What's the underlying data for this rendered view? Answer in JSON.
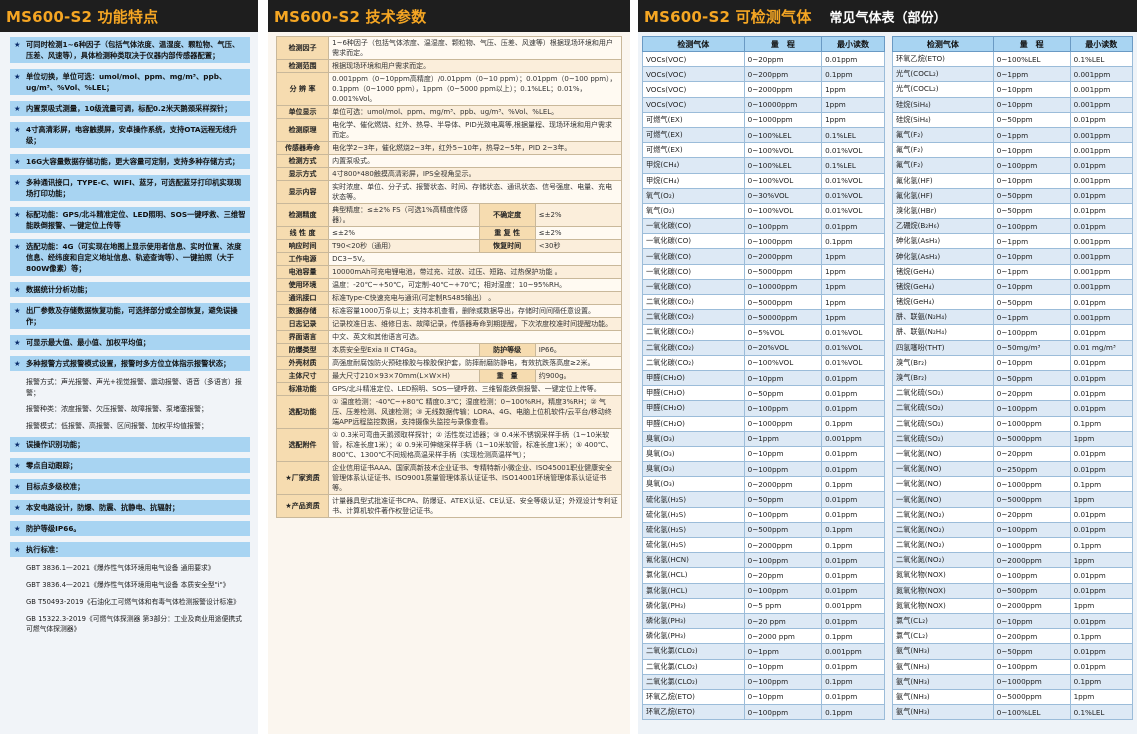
{
  "panel1": {
    "title": "MS600-S2 功能特点",
    "features": [
      {
        "type": "feat",
        "text": "可同时检测1~6种因子（包括气体浓度、温湿度、颗粒物、气压、压差、风速等），具体检测种类取决于仪器内部传感器配置；"
      },
      {
        "type": "feat",
        "text": "单位切换，单位可选：umol/mol、ppm、mg/m³、ppb、ug/m³、%Vol、%LEL；"
      },
      {
        "type": "feat",
        "text": "内置泵吸式测量，10级流量可调，标配0.2米天鹅颈采样探针；"
      },
      {
        "type": "feat",
        "text": "4寸高清彩屏，电容触摸屏，安卓操作系统，支持OTA远程无线升级；"
      },
      {
        "type": "feat",
        "text": "16G大容量数据存储功能，更大容量可定制，支持多种存储方式；"
      },
      {
        "type": "feat",
        "text": "多种通讯接口，TYPE-C、WIFI、蓝牙，可选配蓝牙打印机实现现场打印功能；"
      },
      {
        "type": "feat",
        "text": "标配功能：GPS/北斗精准定位、LED照明、SOS一键呼救、三维智能跌倒报警、一键定位上传等"
      },
      {
        "type": "feat",
        "text": "选配功能：4G（可实现在地图上显示使用者信息、实时位置、浓度信息、经纬度和自定义地址信息、轨迹查询等）、一键拍照（大于800W像素）等；"
      },
      {
        "type": "feat",
        "text": "数据统计分析功能；"
      },
      {
        "type": "feat",
        "text": "出厂参数及存储数据恢复功能，可选择部分或全部恢复，避免误操作；"
      },
      {
        "type": "feat",
        "text": "可显示最大值、最小值、加权平均值；"
      },
      {
        "type": "feat",
        "text": "多种报警方式报警模式设置，报警时多方位立体指示报警状态；"
      },
      {
        "type": "sub",
        "text": "报警方式：声光报警、声光+视觉报警、震动报警、语音（多语言）报警；"
      },
      {
        "type": "sub",
        "text": "报警种类：浓度报警、欠压报警、故障报警、泵堵塞报警；"
      },
      {
        "type": "sub",
        "text": "报警模式：低报警、高报警、区间报警、加权平均值报警；"
      },
      {
        "type": "feat",
        "text": "误操作识别功能；"
      },
      {
        "type": "feat",
        "text": "零点自动跟踪；"
      },
      {
        "type": "feat",
        "text": "目标点多级校准；"
      },
      {
        "type": "feat",
        "text": "本安电路设计，防爆、防震、抗静电、抗辐射；"
      },
      {
        "type": "feat",
        "text": "防护等级IP66。"
      },
      {
        "type": "feat",
        "text": "执行标准："
      },
      {
        "type": "std",
        "text": "GBT 3836.1—2021《爆炸性气体环境用电气设备 通用要求》"
      },
      {
        "type": "std",
        "text": "GBT 3836.4—2021《爆炸性气体环境用电气设备 本质安全型\"i\"》"
      },
      {
        "type": "std",
        "text": "GB T50493-2019《石油化工可燃气体和有毒气体检测报警设计标准》"
      },
      {
        "type": "std",
        "text": "GB 15322.3-2019《可燃气体探测器 第3部分：工业及商业用途便携式可燃气体探测器》"
      }
    ]
  },
  "panel2": {
    "title": "MS600-S2 技术参数",
    "rows": [
      {
        "k": "检测因子",
        "v": "1~6种因子（包括气体浓度、温湿度、颗粒物、气压、压差、风速等）根据现场环境和用户需求而定。"
      },
      {
        "k": "检测范围",
        "v": "根据现场环境和用户需求而定。"
      },
      {
        "k": "分 辨 率",
        "v": "0.001ppm（0~10ppm高精度）/0.01ppm（0~10 ppm）；0.01ppm（0~100 ppm），0.1ppm（0~1000 ppm），1ppm（0~5000 ppm以上）；0.1%LEL；0.01%，0.001%Vol。"
      },
      {
        "k": "单位显示",
        "v": "单位可选：umol/mol、ppm、mg/m³、ppb、ug/m³、%Vol、%LEL。"
      },
      {
        "k": "检测原理",
        "v": "电化学、催化燃烧、红外、热导、半导体、PID光致电离等,根据量程、现场环境和用户需求而定。"
      },
      {
        "k": "传感器寿命",
        "v": "电化学2~3年，催化燃烧2~3年，红外5~10年，热导2~5年，PID 2~3年。"
      },
      {
        "k": "检测方式",
        "v": "内置泵吸式。"
      },
      {
        "k": "显示方式",
        "v": "4寸800*480触摸高清彩屏，IPS全视角显示。"
      },
      {
        "k": "显示内容",
        "v": "实时浓度、单位、分子式、报警状态、时间、存储状态、通讯状态、信号强度、电量、充电状态等。"
      },
      {
        "k": "检测精度",
        "v": "典型精度：≤±2% FS（可选1%高精度传感器）。",
        "k2": "不确定度",
        "v2": "≤±2%"
      },
      {
        "k": "线 性 度",
        "v": "≤±2%",
        "k2": "重 复 性",
        "v2": "≤±2%"
      },
      {
        "k": "响应时间",
        "v": "T90<20秒（通用）",
        "k2": "恢复时间",
        "v2": "<30秒"
      },
      {
        "k": "工作电源",
        "v": "DC3~5V。"
      },
      {
        "k": "电池容量",
        "v": "10000mAh可充电锂电池，带过充、过放、过压、短路、过热保护功能 。"
      },
      {
        "k": "使用环境",
        "v": "温度：-20℃~+50℃，可定制-40℃~+70℃；相对湿度：10~95%RH。"
      },
      {
        "k": "通讯接口",
        "v": "标准Type-C快速充电与通讯(可定制RS485输出） 。"
      },
      {
        "k": "数据存储",
        "v": "标准容量1000万条以上；支持本机查看，删除或数据导出，存储时间间隔任意设置。"
      },
      {
        "k": "日志记录",
        "v": "记录校准日志、维修日志、故障记录，传感器寿命到期提醒，下次浓度校准时间提醒功能。"
      },
      {
        "k": "界面语言",
        "v": "中文、英文和其他语言可选。"
      },
      {
        "k": "防爆类型",
        "v": "本质安全型Exia II CT4Ga。",
        "k2": "防护等级",
        "v2": "IP66。"
      },
      {
        "k": "外壳材质",
        "v": "高强度耐腐蚀防火预硅橡胶与橡胶保护套，防摔耐磨防静电，有效抗跌落高度≥2米。"
      },
      {
        "k": "主体尺寸",
        "v": "最大尺寸210×93×70mm(L×W×H)",
        "k2": "重　量",
        "v2": "约900g。"
      },
      {
        "k": "标准功能",
        "v": "GPS/北斗精准定位、LED照明、SOS一键呼救、三维智能跌倒报警、一键定位上传等。"
      },
      {
        "k": "选配功能",
        "v": "① 温度检测：-40℃~+80℃ 精度0.3℃；湿度检测：0~100%RH，精度3%RH；② 气压、压差检测、风速检测；③ 无线数据传输：LORA、4G、电脑上位机软件/云平台/移动终端APP远程监控数据，支持摄像头监控与录像查看。"
      },
      {
        "k": "选配附件",
        "v": "① 0.3米可弯曲天鹅颈取样探针；② 活性炭过滤器；③ 0.4米不锈钢采样手柄（1~10米软管，标准长度1米）；④ 0.9米可伸缩采样手柄（1~10米软管，标准长度1米）；⑤ 400℃、800℃、1300℃不同规格高温采样手柄（实现检测高温样气）；"
      },
      {
        "k": "★厂家资质",
        "v": "企业信用证书AAA、国家高新技术企业证书、专精特新小微企业、ISO45001职业健康安全管理体系认证证书、ISO9001质量管理体系认证证书、ISO14001环境管理体系认证证书等。"
      },
      {
        "k": "★产品资质",
        "v": "计量器具型式批准证书CPA、防爆证、ATEX认证、CE认证、安全等级认证；外观设计专利证书、计算机软件著作权登记证书。"
      }
    ]
  },
  "panel3": {
    "title": "MS600-S2 可检测气体",
    "subtitle": "常见气体表（部份）",
    "headers": [
      "检测气体",
      "量　程",
      "最小读数"
    ],
    "left": [
      [
        "VOCs(VOC)",
        "0~20ppm",
        "0.01ppm"
      ],
      [
        "VOCs(VOC)",
        "0~200ppm",
        "0.1ppm"
      ],
      [
        "VOCs(VOC)",
        "0~2000ppm",
        "1ppm"
      ],
      [
        "VOCs(VOC)",
        "0~10000ppm",
        "1ppm"
      ],
      [
        "可燃气(EX)",
        "0~1000ppm",
        "1ppm"
      ],
      [
        "可燃气(EX)",
        "0~100%LEL",
        "0.1%LEL"
      ],
      [
        "可燃气(EX)",
        "0~100%VOL",
        "0.01%VOL"
      ],
      [
        "甲烷(CH₄)",
        "0~100%LEL",
        "0.1%LEL"
      ],
      [
        "甲烷(CH₄)",
        "0~100%VOL",
        "0.01%VOL"
      ],
      [
        "氧气(O₂)",
        "0~30%VOL",
        "0.01%VOL"
      ],
      [
        "氧气(O₂)",
        "0~100%VOL",
        "0.01%VOL"
      ],
      [
        "一氧化碳(CO)",
        "0~100ppm",
        "0.01ppm"
      ],
      [
        "一氧化碳(CO)",
        "0~1000ppm",
        "0.1ppm"
      ],
      [
        "一氧化碳(CO)",
        "0~2000ppm",
        "1ppm"
      ],
      [
        "一氧化碳(CO)",
        "0~5000ppm",
        "1ppm"
      ],
      [
        "一氧化碳(CO)",
        "0~10000ppm",
        "1ppm"
      ],
      [
        "二氧化碳(CO₂)",
        "0~5000ppm",
        "1ppm"
      ],
      [
        "二氧化碳(CO₂)",
        "0~50000ppm",
        "1ppm"
      ],
      [
        "二氧化碳(CO₂)",
        "0~5%VOL",
        "0.01%VOL"
      ],
      [
        "二氧化碳(CO₂)",
        "0~20%VOL",
        "0.01%VOL"
      ],
      [
        "二氧化碳(CO₂)",
        "0~100%VOL",
        "0.01%VOL"
      ],
      [
        "甲醛(CH₂O)",
        "0~10ppm",
        "0.01ppm"
      ],
      [
        "甲醛(CH₂O)",
        "0~50ppm",
        "0.01ppm"
      ],
      [
        "甲醛(CH₂O)",
        "0~100ppm",
        "0.01ppm"
      ],
      [
        "甲醛(CH₂O)",
        "0~1000ppm",
        "0.1ppm"
      ],
      [
        "臭氧(O₃)",
        "0~1ppm",
        "0.001ppm"
      ],
      [
        "臭氧(O₃)",
        "0~10ppm",
        "0.01ppm"
      ],
      [
        "臭氧(O₃)",
        "0~100ppm",
        "0.01ppm"
      ],
      [
        "臭氧(O₃)",
        "0~2000ppm",
        "0.1ppm"
      ],
      [
        "硫化氢(H₂S)",
        "0~50ppm",
        "0.01ppm"
      ],
      [
        "硫化氢(H₂S)",
        "0~100ppm",
        "0.01ppm"
      ],
      [
        "硫化氢(H₂S)",
        "0~500ppm",
        "0.1ppm"
      ],
      [
        "硫化氢(H₂S)",
        "0~2000ppm",
        "0.1ppm"
      ],
      [
        "氰化氢(HCN)",
        "0~100ppm",
        "0.01ppm"
      ],
      [
        "氯化氢(HCL)",
        "0~20ppm",
        "0.01ppm"
      ],
      [
        "氯化氢(HCL)",
        "0~100ppm",
        "0.01ppm"
      ],
      [
        "磷化氢(PH₃)",
        "0~5 ppm",
        "0.001ppm"
      ],
      [
        "磷化氢(PH₃)",
        "0~20 ppm",
        "0.01ppm"
      ],
      [
        "磷化氢(PH₃)",
        "0~2000 ppm",
        "0.1ppm"
      ],
      [
        "二氧化氯(CLO₂)",
        "0~1ppm",
        "0.001ppm"
      ],
      [
        "二氧化氯(CLO₂)",
        "0~10ppm",
        "0.01ppm"
      ],
      [
        "二氧化氯(CLO₂)",
        "0~100ppm",
        "0.1ppm"
      ],
      [
        "环氧乙烷(ETO)",
        "0~10ppm",
        "0.01ppm"
      ],
      [
        "环氧乙烷(ETO)",
        "0~100ppm",
        "0.1ppm"
      ]
    ],
    "right": [
      [
        "环氧乙烷(ETO)",
        "0~100%LEL",
        "0.1%LEL"
      ],
      [
        "光气(COCL₂)",
        "0~1ppm",
        "0.001ppm"
      ],
      [
        "光气(COCL₂)",
        "0~10ppm",
        "0.001ppm"
      ],
      [
        "硅烷(SiH₄)",
        "0~10ppm",
        "0.001ppm"
      ],
      [
        "硅烷(SiH₄)",
        "0~50ppm",
        "0.01ppm"
      ],
      [
        "氟气(F₂)",
        "0~1ppm",
        "0.001ppm"
      ],
      [
        "氟气(F₂)",
        "0~10ppm",
        "0.001ppm"
      ],
      [
        "氟气(F₂)",
        "0~100ppm",
        "0.01ppm"
      ],
      [
        "氟化氢(HF)",
        "0~10ppm",
        "0.001ppm"
      ],
      [
        "氟化氢(HF)",
        "0~50ppm",
        "0.01ppm"
      ],
      [
        "溴化氢(HBr)",
        "0~50ppm",
        "0.01ppm"
      ],
      [
        "乙硼烷(B₂H₆)",
        "0~100ppm",
        "0.01ppm"
      ],
      [
        "砷化氢(AsH₃)",
        "0~1ppm",
        "0.001ppm"
      ],
      [
        "砷化氢(AsH₃)",
        "0~10ppm",
        "0.001ppm"
      ],
      [
        "锗烷(GeH₄)",
        "0~1ppm",
        "0.001ppm"
      ],
      [
        "锗烷(GeH₄)",
        "0~10ppm",
        "0.001ppm"
      ],
      [
        "锗烷(GeH₄)",
        "0~50ppm",
        "0.01ppm"
      ],
      [
        "肼、联氨(N₂H₄)",
        "0~1ppm",
        "0.001ppm"
      ],
      [
        "肼、联氨(N₂H₄)",
        "0~100ppm",
        "0.01ppm"
      ],
      [
        "四氢噻吩(THT)",
        "0~50mg/m³",
        "0.01 mg/m³"
      ],
      [
        "溴气(Br₂)",
        "0~10ppm",
        "0.01ppm"
      ],
      [
        "溴气(Br₂)",
        "0~50ppm",
        "0.01ppm"
      ],
      [
        "二氧化硫(SO₂)",
        "0~20ppm",
        "0.01ppm"
      ],
      [
        "二氧化硫(SO₂)",
        "0~100ppm",
        "0.01ppm"
      ],
      [
        "二氧化硫(SO₂)",
        "0~1000ppm",
        "0.1ppm"
      ],
      [
        "二氧化硫(SO₂)",
        "0~5000ppm",
        "1ppm"
      ],
      [
        "一氧化氮(NO)",
        "0~20ppm",
        "0.01ppm"
      ],
      [
        "一氧化氮(NO)",
        "0~250ppm",
        "0.01ppm"
      ],
      [
        "一氧化氮(NO)",
        "0~1000ppm",
        "0.1ppm"
      ],
      [
        "一氧化氮(NO)",
        "0~5000ppm",
        "1ppm"
      ],
      [
        "二氧化氮(NO₂)",
        "0~20ppm",
        "0.01ppm"
      ],
      [
        "二氧化氮(NO₂)",
        "0~100ppm",
        "0.01ppm"
      ],
      [
        "二氧化氮(NO₂)",
        "0~1000ppm",
        "0.1ppm"
      ],
      [
        "二氧化氮(NO₂)",
        "0~2000ppm",
        "1ppm"
      ],
      [
        "氮氧化物(NOX)",
        "0~100ppm",
        "0.01ppm"
      ],
      [
        "氮氧化物(NOX)",
        "0~500ppm",
        "0.01ppm"
      ],
      [
        "氮氧化物(NOX)",
        "0~2000ppm",
        "1ppm"
      ],
      [
        "氯气(CL₂)",
        "0~10ppm",
        "0.01ppm"
      ],
      [
        "氯气(CL₂)",
        "0~200ppm",
        "0.1ppm"
      ],
      [
        "氨气(NH₃)",
        "0~50ppm",
        "0.01ppm"
      ],
      [
        "氨气(NH₃)",
        "0~100ppm",
        "0.01ppm"
      ],
      [
        "氨气(NH₃)",
        "0~1000ppm",
        "0.1ppm"
      ],
      [
        "氨气(NH₃)",
        "0~5000ppm",
        "1ppm"
      ],
      [
        "氨气(NH₃)",
        "0~100%LEL",
        "0.1%LEL"
      ]
    ]
  }
}
